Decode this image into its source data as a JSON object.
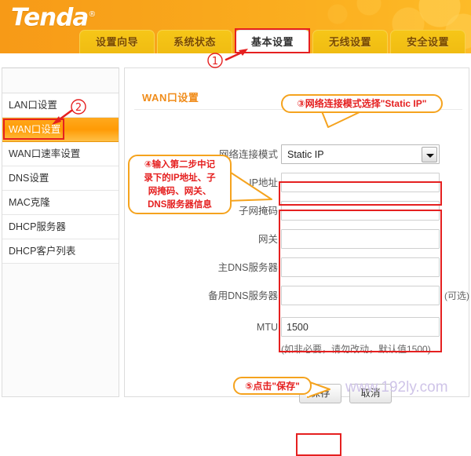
{
  "brand": {
    "name": "Tenda",
    "registered": "®"
  },
  "tabs": [
    {
      "label": "设置向导",
      "active": false
    },
    {
      "label": "系统状态",
      "active": false
    },
    {
      "label": "基本设置",
      "active": true
    },
    {
      "label": "无线设置",
      "active": false
    },
    {
      "label": "安全设置",
      "active": false
    }
  ],
  "sidebar": {
    "items": [
      {
        "label": "LAN口设置",
        "active": false
      },
      {
        "label": "WAN口设置",
        "active": true
      },
      {
        "label": "WAN口速率设置",
        "active": false
      },
      {
        "label": "DNS设置",
        "active": false
      },
      {
        "label": "MAC克隆",
        "active": false
      },
      {
        "label": "DHCP服务器",
        "active": false
      },
      {
        "label": "DHCP客户列表",
        "active": false
      }
    ]
  },
  "main": {
    "section_title": "WAN口设置",
    "fields": {
      "mode_label": "网络连接模式",
      "mode_value": "Static IP",
      "ip_label": "IP地址",
      "ip_value": "",
      "mask_label": "子网掩码",
      "mask_value": "",
      "gateway_label": "网关",
      "gateway_value": "",
      "dns1_label": "主DNS服务器",
      "dns1_value": "",
      "dns2_label": "备用DNS服务器",
      "dns2_value": "",
      "dns2_note": "(可选)",
      "mtu_label": "MTU",
      "mtu_value": "1500",
      "mtu_hint": "(如非必要，请勿改动，默认值1500)"
    },
    "buttons": {
      "save": "保存",
      "cancel": "取消"
    }
  },
  "annotations": {
    "marker1": "①",
    "marker2": "②",
    "callout3": "③网络连接模式选择\"Static IP\"",
    "callout4_lines": [
      "④输入第二步中记",
      "录下的IP地址、子",
      "网掩码、网关、",
      "DNS服务器信息"
    ],
    "callout5": "⑤点击\"保存\""
  },
  "watermark": "www.192ly.com",
  "colors": {
    "brand_orange": "#f5a623",
    "tab_gold": "#f0bc12",
    "accent_red": "#e52020",
    "callout_border": "#f5a31e",
    "section_title": "#f08c1a",
    "watermark": "#cfc4e8"
  }
}
